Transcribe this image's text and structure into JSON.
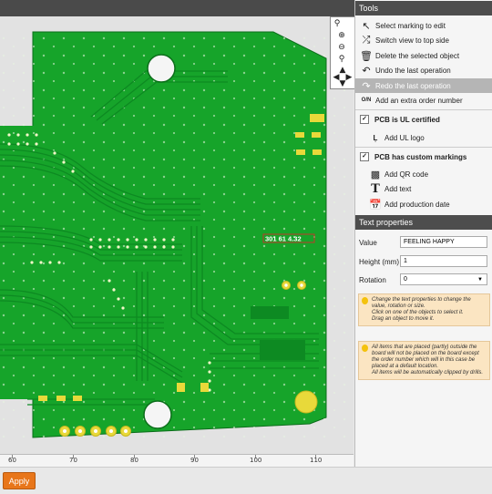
{
  "tools": {
    "header": "Tools",
    "items": [
      {
        "icon": "cursor-icon",
        "label": "Select marking to edit"
      },
      {
        "icon": "flip-view-icon",
        "label": "Switch view to top side"
      },
      {
        "icon": "trash-icon",
        "label": "Delete the selected object"
      },
      {
        "icon": "undo-icon",
        "label": "Undo the last operation"
      },
      {
        "icon": "redo-icon",
        "label": "Redo the last operation"
      },
      {
        "icon": "order-number-icon",
        "label": "Add an extra order number"
      }
    ],
    "ul_certified_label": "PCB is UL certified",
    "add_ul_logo": "Add UL logo",
    "custom_markings_label": "PCB has custom markings",
    "add_qr": "Add QR code",
    "add_text": "Add text",
    "add_date": "Add production date"
  },
  "text_properties": {
    "header": "Text properties",
    "value_label": "Value",
    "value": "FEELING HAPPY",
    "height_label": "Height (mm)",
    "height": "1",
    "rotation_label": "Rotation",
    "rotation": "0"
  },
  "notes": {
    "note1_line1": "Change the text properties to change the value, rotation or size.",
    "note1_line2": "Click on one of the objects to select it.",
    "note1_line3": "Drag an object to move it.",
    "note2_line1": "All items that are placed (partly) outside the board will not be placed on the board except the order number which will in this case be placed at a default location.",
    "note2_line2": "All items will be automatically clipped by drills."
  },
  "board": {
    "marking_text": "301 61 4.32"
  },
  "ruler": {
    "labels": [
      "60",
      "70",
      "80",
      "90",
      "100",
      "110"
    ]
  },
  "apply_label": "Apply",
  "colors": {
    "board_green": "#16a42a",
    "trace_green": "#0d8a22",
    "pad_yellow": "#e8d93a",
    "accent_orange": "#e8761a",
    "header_dark": "#4d4d4d"
  }
}
